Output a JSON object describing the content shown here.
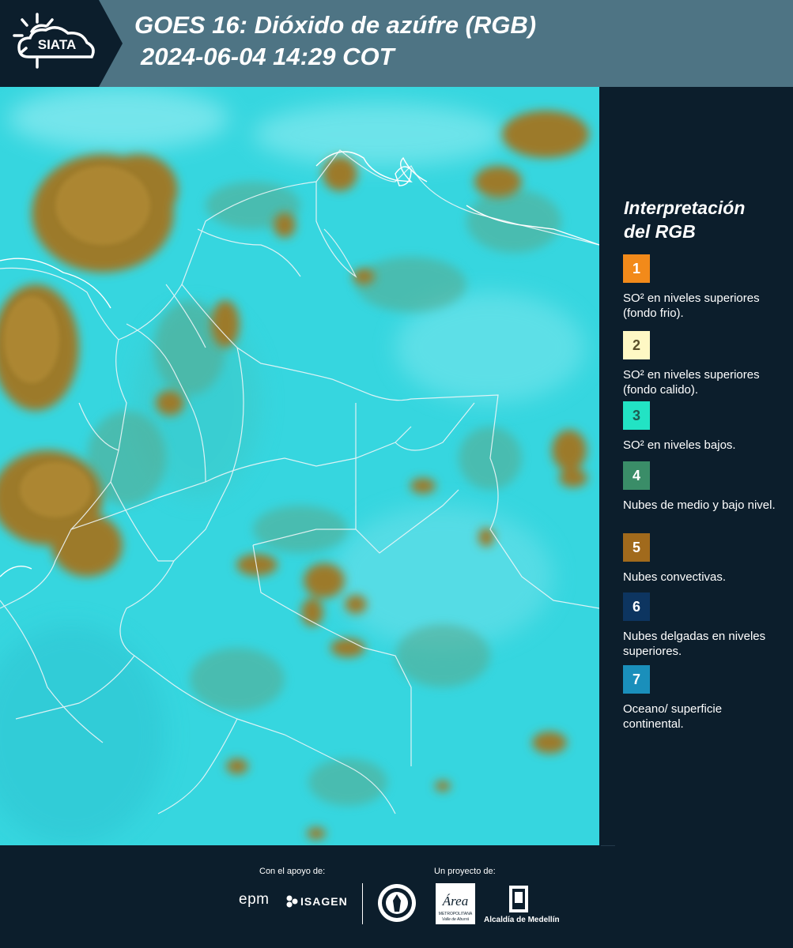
{
  "header": {
    "logo_text": "SIATA",
    "title_line1": "GOES 16: Dióxido de azúfre (RGB)",
    "title_line2": "2024-06-04 14:29 COT"
  },
  "map": {
    "image_type": "GOES-16 SO2 RGB composite over Colombia"
  },
  "legend": {
    "title_line1": "Interpretación",
    "title_line2": "del RGB",
    "items": [
      {
        "number": "1",
        "color": "#f28a1a",
        "label": "SO² en niveles superiores (fondo frio)."
      },
      {
        "number": "2",
        "color": "#fef8c4",
        "label": "SO² en niveles superiores (fondo calido)."
      },
      {
        "number": "3",
        "color": "#22e3c4",
        "label": "SO² en niveles bajos."
      },
      {
        "number": "4",
        "color": "#3a8d68",
        "label": "Nubes de medio y bajo nivel."
      },
      {
        "number": "5",
        "color": "#a16a1c",
        "label": "Nubes convectivas."
      },
      {
        "number": "6",
        "color": "#0d3560",
        "label": "Nubes delgadas en niveles superiores."
      },
      {
        "number": "7",
        "color": "#1a8fbb",
        "label": "Oceano/ superficie continental."
      }
    ]
  },
  "footer": {
    "support_label": "Con el apoyo de:",
    "project_label": "Un proyecto de:",
    "epm_text": "epm",
    "isagen_text": "ISAGEN",
    "area_text": "Área",
    "area_sub": "METROPOLITANA",
    "area_sub2": "Valle de Aburrá",
    "alcaldia_text": "Alcaldía de Medellín"
  }
}
